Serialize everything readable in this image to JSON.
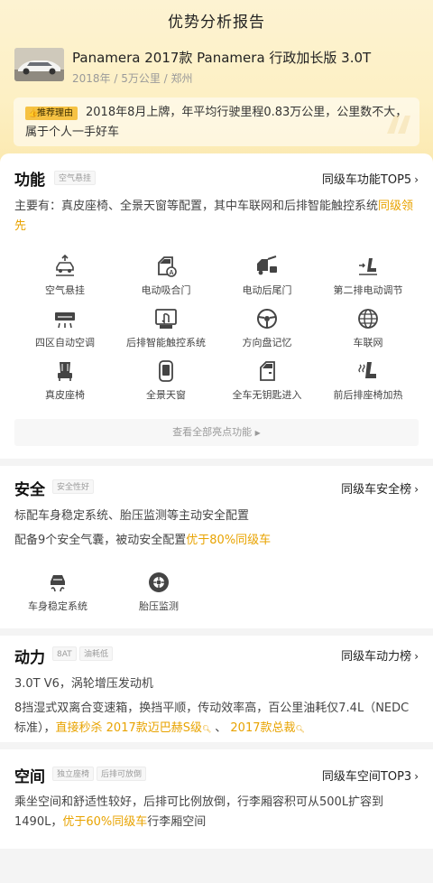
{
  "header": {
    "title": "优势分析报告",
    "car_name": "Panamera 2017款 Panamera 行政加长版 3.0T",
    "car_meta": "2018年 / 5万公里 / 郑州",
    "reason_badge": "推荐理由",
    "reason_text": "2018年8月上牌，年平均行驶里程0.83万公里，公里数不大，属于个人一手好车"
  },
  "function": {
    "title": "功能",
    "tag": "空气悬挂",
    "rank_link": "同级车功能TOP5",
    "summary_plain": "主要有：真皮座椅、全景天窗等配置，其中车联网和后排智能触控系统",
    "summary_highlight": "同级领先",
    "items": [
      {
        "label": "空气悬挂",
        "icon": "air-suspension-icon"
      },
      {
        "label": "电动吸合门",
        "icon": "soft-close-door-icon"
      },
      {
        "label": "电动后尾门",
        "icon": "power-tailgate-icon"
      },
      {
        "label": "第二排电动调节",
        "icon": "second-row-power-seat-icon"
      },
      {
        "label": "四区自动空调",
        "icon": "four-zone-ac-icon"
      },
      {
        "label": "后排智能触控系统",
        "icon": "rear-touch-control-icon"
      },
      {
        "label": "方向盘记忆",
        "icon": "steering-wheel-memory-icon"
      },
      {
        "label": "车联网",
        "icon": "connected-car-icon"
      },
      {
        "label": "真皮座椅",
        "icon": "leather-seat-icon"
      },
      {
        "label": "全景天窗",
        "icon": "panoramic-sunroof-icon"
      },
      {
        "label": "全车无钥匙进入",
        "icon": "keyless-entry-icon"
      },
      {
        "label": "前后排座椅加热",
        "icon": "seat-heating-icon"
      }
    ],
    "view_all": "查看全部亮点功能"
  },
  "safety": {
    "title": "安全",
    "tag": "安全性好",
    "rank_link": "同级车安全榜",
    "line1": "标配车身稳定系统、胎压监测等主动安全配置",
    "line2_plain": "配备9个安全气囊，被动安全配置",
    "line2_highlight": "优于80%同级车",
    "items": [
      {
        "label": "车身稳定系统",
        "icon": "stability-control-icon"
      },
      {
        "label": "胎压监测",
        "icon": "tire-pressure-icon"
      }
    ]
  },
  "power": {
    "title": "动力",
    "tags": [
      "8AT",
      "油耗低"
    ],
    "rank_link": "同级车动力榜",
    "line1": "3.0T V6，涡轮增压发动机",
    "line2_plain": "8挡湿式双离合变速箱，换挡平顺，传动效率高，百公里油耗仅7.4L（NEDC标准），",
    "line2_highlight1": "直接秒杀 2017款迈巴赫S级",
    "line2_sep": " 、 ",
    "line2_highlight2": "2017款总裁"
  },
  "space": {
    "title": "空间",
    "tags": [
      "独立座椅",
      "后排可放倒"
    ],
    "rank_link": "同级车空间TOP3",
    "line_plain1": "乘坐空间和舒适性较好，后排可比例放倒，行李厢容积可从500L扩容到1490L，",
    "line_highlight": "优于60%同级车",
    "line_plain2": "行李厢空间"
  },
  "colors": {
    "accent": "#e8a300",
    "badge_bg": "#f6c243",
    "hero_bg": "#fdf0c4"
  }
}
